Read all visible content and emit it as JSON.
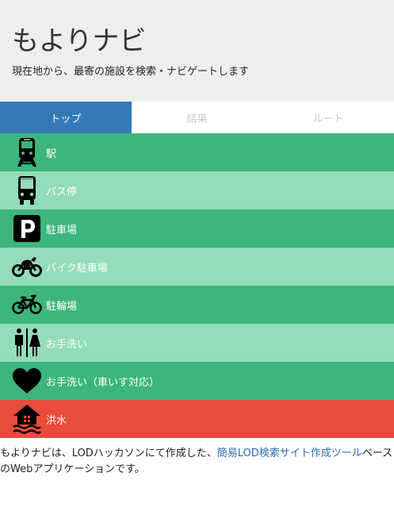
{
  "header": {
    "title": "もよりナビ",
    "subtitle": "現在地から、最寄の施設を検索・ナビゲートします"
  },
  "tabs": [
    {
      "label": "トップ",
      "active": true
    },
    {
      "label": "結果",
      "active": false
    },
    {
      "label": "ルート",
      "active": false
    }
  ],
  "colors": {
    "tab_active": "#337ab7",
    "row_dark": "#3cb67c",
    "row_light": "#94dcba",
    "row_alert": "#e74c3c",
    "link": "#2a6fb0"
  },
  "categories": [
    {
      "label": "駅",
      "icon": "train-icon"
    },
    {
      "label": "バス停",
      "icon": "bus-icon"
    },
    {
      "label": "駐車場",
      "icon": "parking-icon"
    },
    {
      "label": "バイク駐車場",
      "icon": "motorcycle-icon"
    },
    {
      "label": "駐輪場",
      "icon": "bicycle-icon"
    },
    {
      "label": "お手洗い",
      "icon": "restroom-icon"
    },
    {
      "label": "お手洗い（車いす対応）",
      "icon": "heart-icon"
    },
    {
      "label": "洪水",
      "icon": "flood-house-icon"
    }
  ],
  "footer": {
    "text_before": "もよりナビは、LODハッカソンにて作成した、",
    "link_text": "簡易LOD検索サイト作成ツール",
    "text_after": "ベースのWebアプリケーションです。"
  }
}
